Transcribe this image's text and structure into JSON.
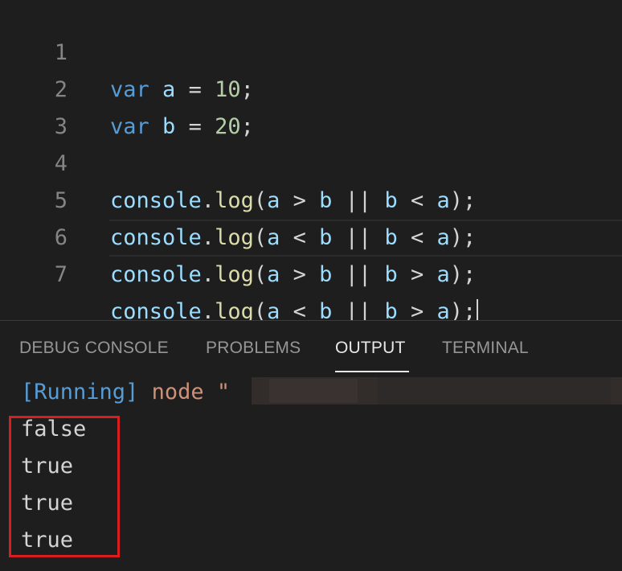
{
  "editor": {
    "lines": [
      {
        "number": "1",
        "tokens": [
          [
            "kw",
            "var"
          ],
          [
            "op",
            " "
          ],
          [
            "var",
            "a"
          ],
          [
            "op",
            " = "
          ],
          [
            "num",
            "10"
          ],
          [
            "op",
            ";"
          ]
        ]
      },
      {
        "number": "2",
        "tokens": [
          [
            "kw",
            "var"
          ],
          [
            "op",
            " "
          ],
          [
            "var",
            "b"
          ],
          [
            "op",
            " = "
          ],
          [
            "num",
            "20"
          ],
          [
            "op",
            ";"
          ]
        ]
      },
      {
        "number": "3",
        "tokens": []
      },
      {
        "number": "4",
        "tokens": [
          [
            "var",
            "console"
          ],
          [
            "op",
            "."
          ],
          [
            "fn",
            "log"
          ],
          [
            "op",
            "("
          ],
          [
            "var",
            "a"
          ],
          [
            "op",
            " > "
          ],
          [
            "var",
            "b"
          ],
          [
            "op",
            " || "
          ],
          [
            "var",
            "b"
          ],
          [
            "op",
            " < "
          ],
          [
            "var",
            "a"
          ],
          [
            "op",
            ");"
          ]
        ]
      },
      {
        "number": "5",
        "tokens": [
          [
            "var",
            "console"
          ],
          [
            "op",
            "."
          ],
          [
            "fn",
            "log"
          ],
          [
            "op",
            "("
          ],
          [
            "var",
            "a"
          ],
          [
            "op",
            " < "
          ],
          [
            "var",
            "b"
          ],
          [
            "op",
            " || "
          ],
          [
            "var",
            "b"
          ],
          [
            "op",
            " < "
          ],
          [
            "var",
            "a"
          ],
          [
            "op",
            ");"
          ]
        ]
      },
      {
        "number": "6",
        "tokens": [
          [
            "var",
            "console"
          ],
          [
            "op",
            "."
          ],
          [
            "fn",
            "log"
          ],
          [
            "op",
            "("
          ],
          [
            "var",
            "a"
          ],
          [
            "op",
            " > "
          ],
          [
            "var",
            "b"
          ],
          [
            "op",
            " || "
          ],
          [
            "var",
            "b"
          ],
          [
            "op",
            " > "
          ],
          [
            "var",
            "a"
          ],
          [
            "op",
            ");"
          ]
        ]
      },
      {
        "number": "7",
        "tokens": [
          [
            "var",
            "console"
          ],
          [
            "op",
            "."
          ],
          [
            "fn",
            "log"
          ],
          [
            "op",
            "("
          ],
          [
            "var",
            "a"
          ],
          [
            "op",
            " < "
          ],
          [
            "var",
            "b"
          ],
          [
            "op",
            " || "
          ],
          [
            "var",
            "b"
          ],
          [
            "op",
            " > "
          ],
          [
            "var",
            "a"
          ],
          [
            "op",
            ");"
          ]
        ]
      }
    ],
    "current_line": "7"
  },
  "panel": {
    "tabs": {
      "debug_console": "DEBUG CONSOLE",
      "problems": "PROBLEMS",
      "output": "OUTPUT",
      "terminal": "TERMINAL"
    },
    "active_tab": "OUTPUT",
    "output": {
      "running_tag": "[Running]",
      "command": " node \"",
      "results": [
        "false",
        "true",
        "true",
        "true"
      ]
    }
  },
  "colors": {
    "keyword": "#569cd6",
    "variable": "#9cdcfe",
    "number": "#b5cea8",
    "function": "#dcdcaa",
    "string": "#ce9178",
    "highlight_box": "#d81e1e"
  }
}
